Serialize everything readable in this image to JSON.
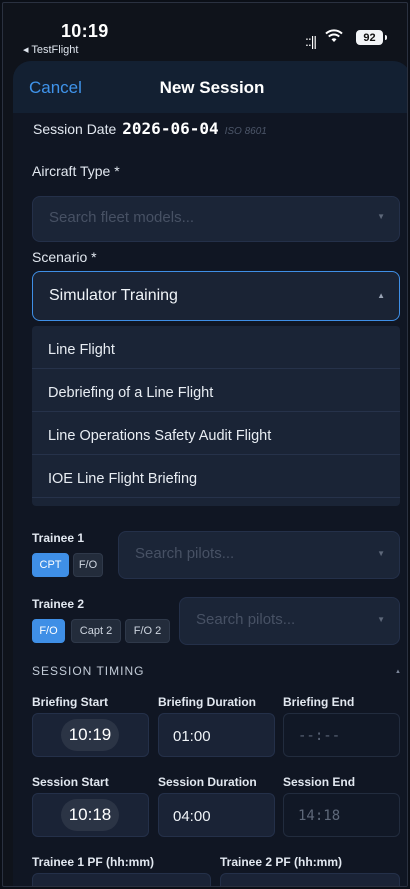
{
  "status_bar": {
    "time": "10:19",
    "back_app": "◂ TestFlight",
    "signal": "::||",
    "battery": "92"
  },
  "nav": {
    "cancel": "Cancel",
    "title": "New Session"
  },
  "session_date": {
    "label": "Session Date",
    "value": "2026-06-04",
    "format": "ISO 8601"
  },
  "aircraft": {
    "label": "Aircraft Type *",
    "placeholder": "Search fleet models..."
  },
  "scenario": {
    "label": "Scenario *",
    "value": "Simulator Training",
    "options": [
      "Line Flight",
      "Debriefing of a Line Flight",
      "Line Operations Safety Audit Flight",
      "IOE Line Flight Briefing"
    ]
  },
  "trainee1": {
    "label": "Trainee 1",
    "roles": [
      "CPT",
      "F/O"
    ],
    "active_role": "CPT",
    "placeholder": "Search pilots..."
  },
  "trainee2": {
    "label": "Trainee 2",
    "roles": [
      "F/O",
      "Capt 2",
      "F/O 2"
    ],
    "active_role": "F/O",
    "placeholder": "Search pilots..."
  },
  "timing": {
    "section_title": "SESSION TIMING",
    "briefing_start_label": "Briefing Start",
    "briefing_start": "10:19",
    "briefing_duration_label": "Briefing Duration",
    "briefing_duration": "01:00",
    "briefing_end_label": "Briefing End",
    "briefing_end": "--:--",
    "session_start_label": "Session Start",
    "session_start": "10:18",
    "session_duration_label": "Session Duration",
    "session_duration": "04:00",
    "session_end_label": "Session End",
    "session_end": "14:18"
  },
  "pf": {
    "trainee1_label": "Trainee 1 PF (hh:mm)",
    "trainee2_label": "Trainee 2 PF (hh:mm)"
  },
  "colors": {
    "accent": "#3f8fe6",
    "background": "#101623",
    "field": "#1b2537"
  }
}
